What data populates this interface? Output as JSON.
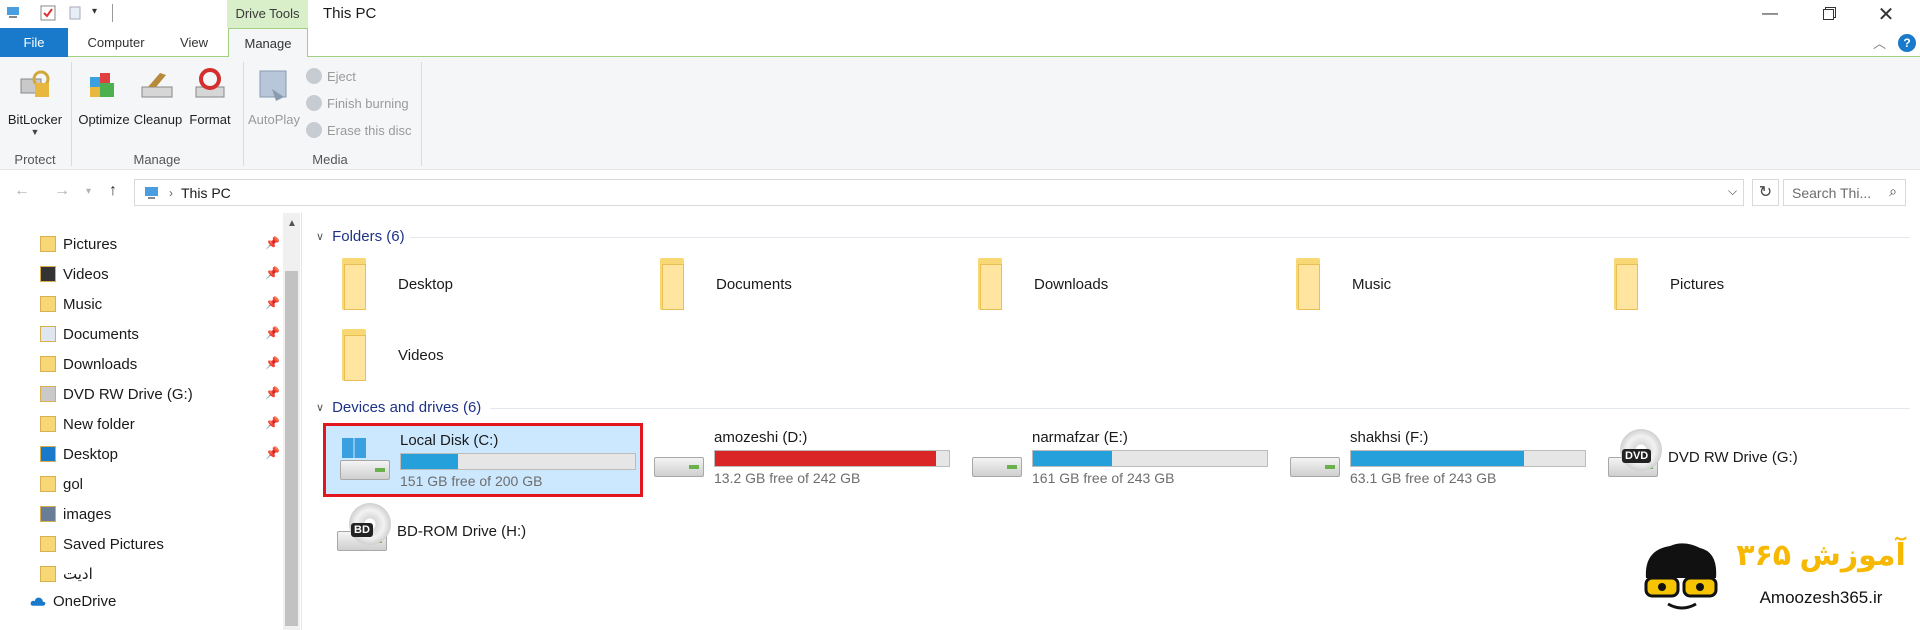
{
  "window": {
    "contextual_tab": "Drive Tools",
    "title": "This PC"
  },
  "tabs": [
    {
      "label": "File"
    },
    {
      "label": "Computer"
    },
    {
      "label": "View"
    },
    {
      "label": "Manage"
    }
  ],
  "ribbon": {
    "bitlocker": "BitLocker",
    "optimize": "Optimize",
    "cleanup": "Cleanup",
    "format": "Format",
    "autoplay": "AutoPlay",
    "eject": "Eject",
    "finish_burning": "Finish burning",
    "erase_disc": "Erase this disc",
    "groups": {
      "protect": "Protect",
      "manage": "Manage",
      "media": "Media"
    }
  },
  "address": {
    "path": "This PC",
    "search_placeholder": "Search Thi..."
  },
  "nav": [
    {
      "label": "Pictures",
      "icon": "pictures-folder-icon",
      "pinned": true
    },
    {
      "label": "Videos",
      "icon": "videos-folder-icon",
      "pinned": true
    },
    {
      "label": "Music",
      "icon": "music-folder-icon",
      "pinned": true
    },
    {
      "label": "Documents",
      "icon": "documents-folder-icon",
      "pinned": true
    },
    {
      "label": "Downloads",
      "icon": "downloads-folder-icon",
      "pinned": true
    },
    {
      "label": "DVD RW Drive (G:)",
      "icon": "dvd-drive-icon",
      "pinned": true
    },
    {
      "label": "New folder",
      "icon": "folder-icon",
      "pinned": true
    },
    {
      "label": "Desktop",
      "icon": "desktop-icon",
      "pinned": true
    },
    {
      "label": "gol",
      "icon": "folder-icon",
      "pinned": false
    },
    {
      "label": "images",
      "icon": "images-folder-icon",
      "pinned": false
    },
    {
      "label": "Saved Pictures",
      "icon": "folder-icon",
      "pinned": false
    },
    {
      "label": "ادیت",
      "icon": "folder-icon",
      "pinned": false
    }
  ],
  "onedrive": "OneDrive",
  "folders_header": "Folders (6)",
  "folders": [
    {
      "label": "Desktop"
    },
    {
      "label": "Documents"
    },
    {
      "label": "Downloads"
    },
    {
      "label": "Music"
    },
    {
      "label": "Pictures"
    },
    {
      "label": "Videos"
    }
  ],
  "devices_header": "Devices and drives (6)",
  "drives": [
    {
      "name": "Local Disk (C:)",
      "free": "151 GB free of 200 GB",
      "used_fraction": 0.245,
      "bar_color": "#26a0da"
    },
    {
      "name": "amozeshi (D:)",
      "free": "13.2 GB free of 242 GB",
      "used_fraction": 0.945,
      "bar_color": "#da2626"
    },
    {
      "name": "narmafzar (E:)",
      "free": "161 GB free of 243 GB",
      "used_fraction": 0.337,
      "bar_color": "#26a0da"
    },
    {
      "name": "shakhsi (F:)",
      "free": "63.1 GB free of 243 GB",
      "used_fraction": 0.74,
      "bar_color": "#26a0da"
    },
    {
      "name": "DVD RW Drive (G:)",
      "label": "DVD"
    },
    {
      "name": "BD-ROM Drive (H:)",
      "label": "BD"
    }
  ],
  "logo": {
    "persian": "آموزش ۳۶۵",
    "latin": "Amoozesh365.ir"
  },
  "colors": {
    "accent": "#1979ca",
    "selection": "#cce8ff",
    "highlight_border": "#e3151e",
    "drive_tools": "#d8efc9"
  }
}
